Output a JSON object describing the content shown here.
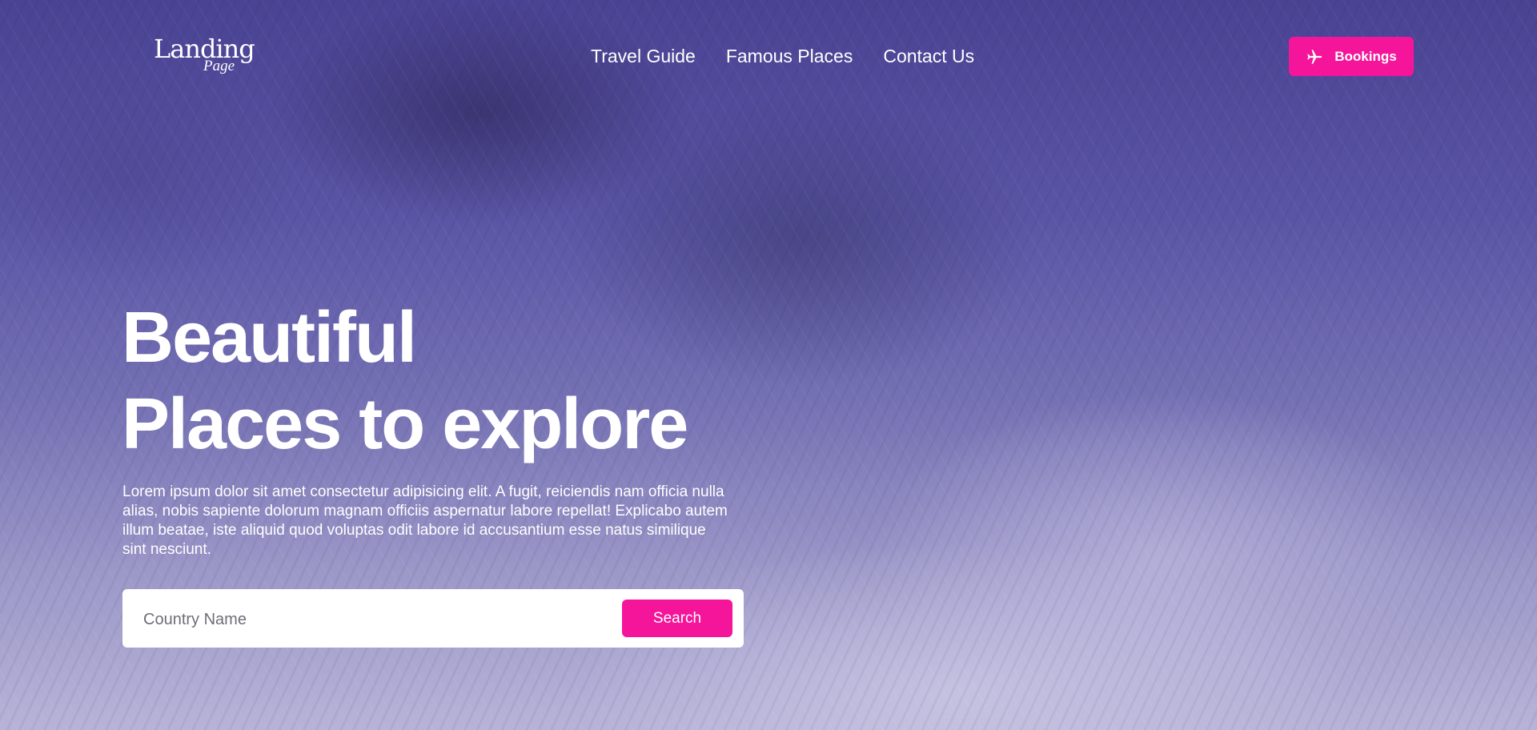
{
  "logo": {
    "main": "Landing",
    "sub": "Page"
  },
  "nav": {
    "links": [
      {
        "label": "Travel Guide"
      },
      {
        "label": "Famous Places"
      },
      {
        "label": "Contact Us"
      }
    ],
    "bookings_label": "Bookings",
    "bookings_icon": "plane-icon"
  },
  "hero": {
    "title_line1": "Beautiful",
    "title_line2": "Places to explore",
    "description": "Lorem ipsum dolor sit amet consectetur adipisicing elit. A fugit, reiciendis nam officia nulla alias, nobis sapiente dolorum magnam officiis aspernatur labore repellat! Explicabo autem illum beatae, iste aliquid quod voluptas odit labore id accusantium esse natus similique sint nesciunt."
  },
  "search": {
    "placeholder": "Country Name",
    "value": "",
    "button_label": "Search"
  },
  "colors": {
    "accent": "#f4159a",
    "text": "#ffffff"
  }
}
